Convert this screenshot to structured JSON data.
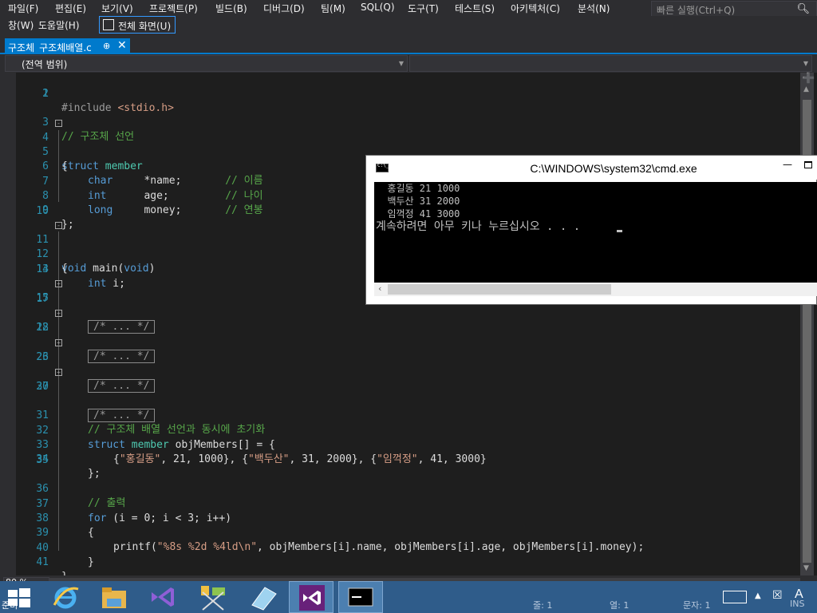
{
  "menu": {
    "row1": [
      "파일(F)",
      "편집(E)",
      "보기(V)",
      "프로젝트(P)",
      "빌드(B)",
      "디버그(D)",
      "팀(M)",
      "SQL(Q)",
      "도구(T)",
      "테스트(S)",
      "아키텍처(C)",
      "분석(N)"
    ],
    "row2": [
      "창(W)",
      "도움말(H)"
    ],
    "fullscreen_label": "전체 화면(U)",
    "quick_launch_placeholder": "빠른 실행(Ctrl+Q)"
  },
  "tab": {
    "label": "구조체_구조체배열.c"
  },
  "navbar": {
    "scope": "(전역 범위)"
  },
  "editor": {
    "lines": [
      {
        "n": "1",
        "html_text": "#include <stdio.h>"
      },
      {
        "n": "2"
      },
      {
        "n": "3",
        "text": "// 구조체 선언"
      },
      {
        "n": "4",
        "text": "struct member"
      },
      {
        "n": "5",
        "text": "{"
      },
      {
        "n": "6",
        "text": "char     *name;       // 이름"
      },
      {
        "n": "7",
        "text": "int      age;         // 나이"
      },
      {
        "n": "8",
        "text": "long     money;       // 연봉"
      },
      {
        "n": "9",
        "text": "};"
      },
      {
        "n": "10"
      },
      {
        "n": "11",
        "text": "void main(void)"
      },
      {
        "n": "12",
        "text": "{"
      },
      {
        "n": "13",
        "text": "int i;"
      },
      {
        "n": "14"
      },
      {
        "n": "15",
        "text": "/* ... */"
      },
      {
        "n": "17"
      },
      {
        "n": "18",
        "text": "/* ... */"
      },
      {
        "n": "22"
      },
      {
        "n": "23",
        "text": "/* ... */"
      },
      {
        "n": "26"
      },
      {
        "n": "27",
        "text": "/* ... */"
      },
      {
        "n": "30"
      },
      {
        "n": "31",
        "text": "// 구조체 배열 선언과 동시에 초기화"
      },
      {
        "n": "32",
        "text": "struct member objMembers[] = {"
      },
      {
        "n": "33",
        "text": "{\"홍길동\", 21, 1000}, {\"백두산\", 31, 2000}, {\"임꺽정\", 41, 3000}"
      },
      {
        "n": "34",
        "text": "};"
      },
      {
        "n": "35"
      },
      {
        "n": "36",
        "text": "// 출력"
      },
      {
        "n": "37",
        "text": "for (i = 0; i < 3; i++)"
      },
      {
        "n": "38",
        "text": "{"
      },
      {
        "n": "39",
        "text": "printf(\"%8s %2d %4ld\\n\", objMembers[i].name, objMembers[i].age, objMembers[i].money);"
      },
      {
        "n": "40",
        "text": "}"
      },
      {
        "n": "41",
        "text": "}"
      }
    ],
    "zoom": "80 %"
  },
  "cmd": {
    "title": "C:\\WINDOWS\\system32\\cmd.exe",
    "icon_text": "C:\\_",
    "output": [
      "  홍길동 21 1000",
      "  백두산 31 2000",
      "  임꺽정 41 3000",
      "계속하려면 아무 키나 누르십시오 . . . "
    ]
  },
  "status": {
    "line": "줄: 1",
    "col": "열: 1",
    "char": "문자: 1",
    "ins": "INS",
    "left_fragment": "준비"
  },
  "colors": {
    "accent": "#007acc",
    "editor_bg": "#1e1e1e",
    "keyword": "#569cd6",
    "type": "#4ec9b0",
    "comment": "#57a64a",
    "string": "#d69d85",
    "line_number": "#2b91af",
    "taskbar": "#2f5c8a"
  },
  "taskbar_apps": [
    "start-icon",
    "internet-explorer-icon",
    "file-explorer-icon",
    "visual-studio-icon",
    "network-tool-icon",
    "notepad-icon",
    "visual-studio-icon",
    "cmd-icon"
  ]
}
